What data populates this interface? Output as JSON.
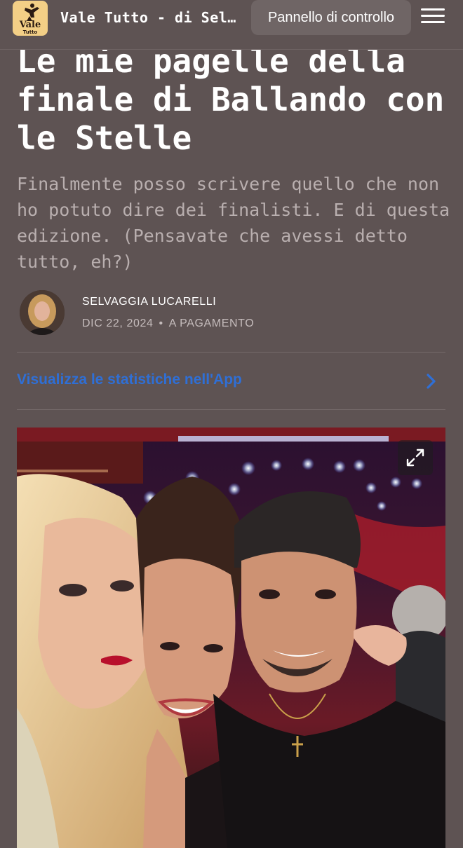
{
  "header": {
    "logo_text_top": "Vale",
    "logo_text_bottom": "Tutto",
    "site_title": "Vale Tutto - di Sel…",
    "dashboard_label": "Pannello di controllo",
    "menu_icon": "hamburger-icon"
  },
  "article": {
    "title": "Le mie pagelle della finale di Ballando con le Stelle",
    "subtitle": "Finalmente posso scrivere quello che non ho potuto dire dei finalisti. E di questa edizione. (Pensavate che avessi detto tutto, eh?)",
    "author": "SELVAGGIA LUCARELLI",
    "date": "DIC 22, 2024",
    "separator": "•",
    "access": "A PAGAMENTO"
  },
  "stats": {
    "link_text": "Visualizza le statistiche nell'App",
    "chevron_icon": "chevron-right-icon"
  },
  "image": {
    "expand_icon": "expand-icon"
  },
  "colors": {
    "background": "#5e5353",
    "link": "#2f6fd6",
    "logo_bg": "#f3cf86"
  }
}
